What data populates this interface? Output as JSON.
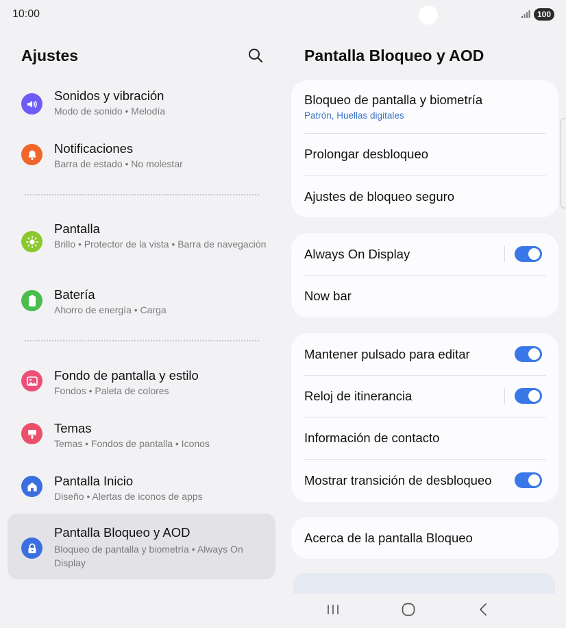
{
  "status_bar": {
    "time": "10:00",
    "battery": "100",
    "signal_icon": "signal-bars-icon"
  },
  "left_pane": {
    "title": "Ajustes",
    "search_icon": "search-icon",
    "items": [
      {
        "title": "Sonidos y vibración",
        "subtitle": "Modo de sonido • Melodía",
        "icon": "speaker-icon",
        "color": "#6e5cf6"
      },
      {
        "title": "Notificaciones",
        "subtitle": "Barra de estado • No molestar",
        "icon": "bell-icon",
        "color": "#f0652a"
      },
      {
        "title": "Pantalla",
        "subtitle": "Brillo • Protector de la vista • Barra de navegación",
        "icon": "sun-icon",
        "color": "#8bc82e"
      },
      {
        "title": "Batería",
        "subtitle": "Ahorro de energía • Carga",
        "icon": "battery-icon",
        "color": "#4bbd4e"
      },
      {
        "title": "Fondo de pantalla y estilo",
        "subtitle": "Fondos • Paleta de colores",
        "icon": "image-icon",
        "color": "#ec4f78"
      },
      {
        "title": "Temas",
        "subtitle": "Temas • Fondos de pantalla • Iconos",
        "icon": "paint-brush-icon",
        "color": "#ec4f6a"
      },
      {
        "title": "Pantalla Inicio",
        "subtitle": "Diseño • Alertas de iconos de apps",
        "icon": "home-icon",
        "color": "#3b6fe0"
      },
      {
        "title": "Pantalla Bloqueo y AOD",
        "subtitle": "Bloqueo de pantalla y biometría • Always On Display",
        "icon": "lock-icon",
        "color": "#3b6fe0",
        "selected": true
      }
    ]
  },
  "right_pane": {
    "title": "Pantalla Bloqueo y AOD",
    "card1": {
      "rows": [
        {
          "label": "Bloqueo de pantalla y biometría",
          "sublabel": "Patrón, Huellas digitales"
        },
        {
          "label": "Prolongar desbloqueo"
        },
        {
          "label": "Ajustes de bloqueo seguro"
        }
      ]
    },
    "card2": {
      "rows": [
        {
          "label": "Always On Display",
          "toggle": true
        },
        {
          "label": "Now bar"
        }
      ]
    },
    "card3": {
      "rows": [
        {
          "label": "Mantener pulsado para editar",
          "toggle": true
        },
        {
          "label": "Reloj de itinerancia",
          "toggle": true
        },
        {
          "label": "Información de contacto"
        },
        {
          "label": "Mostrar transición de desbloqueo",
          "toggle": true
        }
      ]
    },
    "card4": {
      "rows": [
        {
          "label": "Acerca de la pantalla Bloqueo"
        }
      ]
    }
  },
  "nav_bar": {
    "recents_icon": "recents-icon",
    "home_icon": "home-circle-icon",
    "back_icon": "back-chevron-icon"
  }
}
